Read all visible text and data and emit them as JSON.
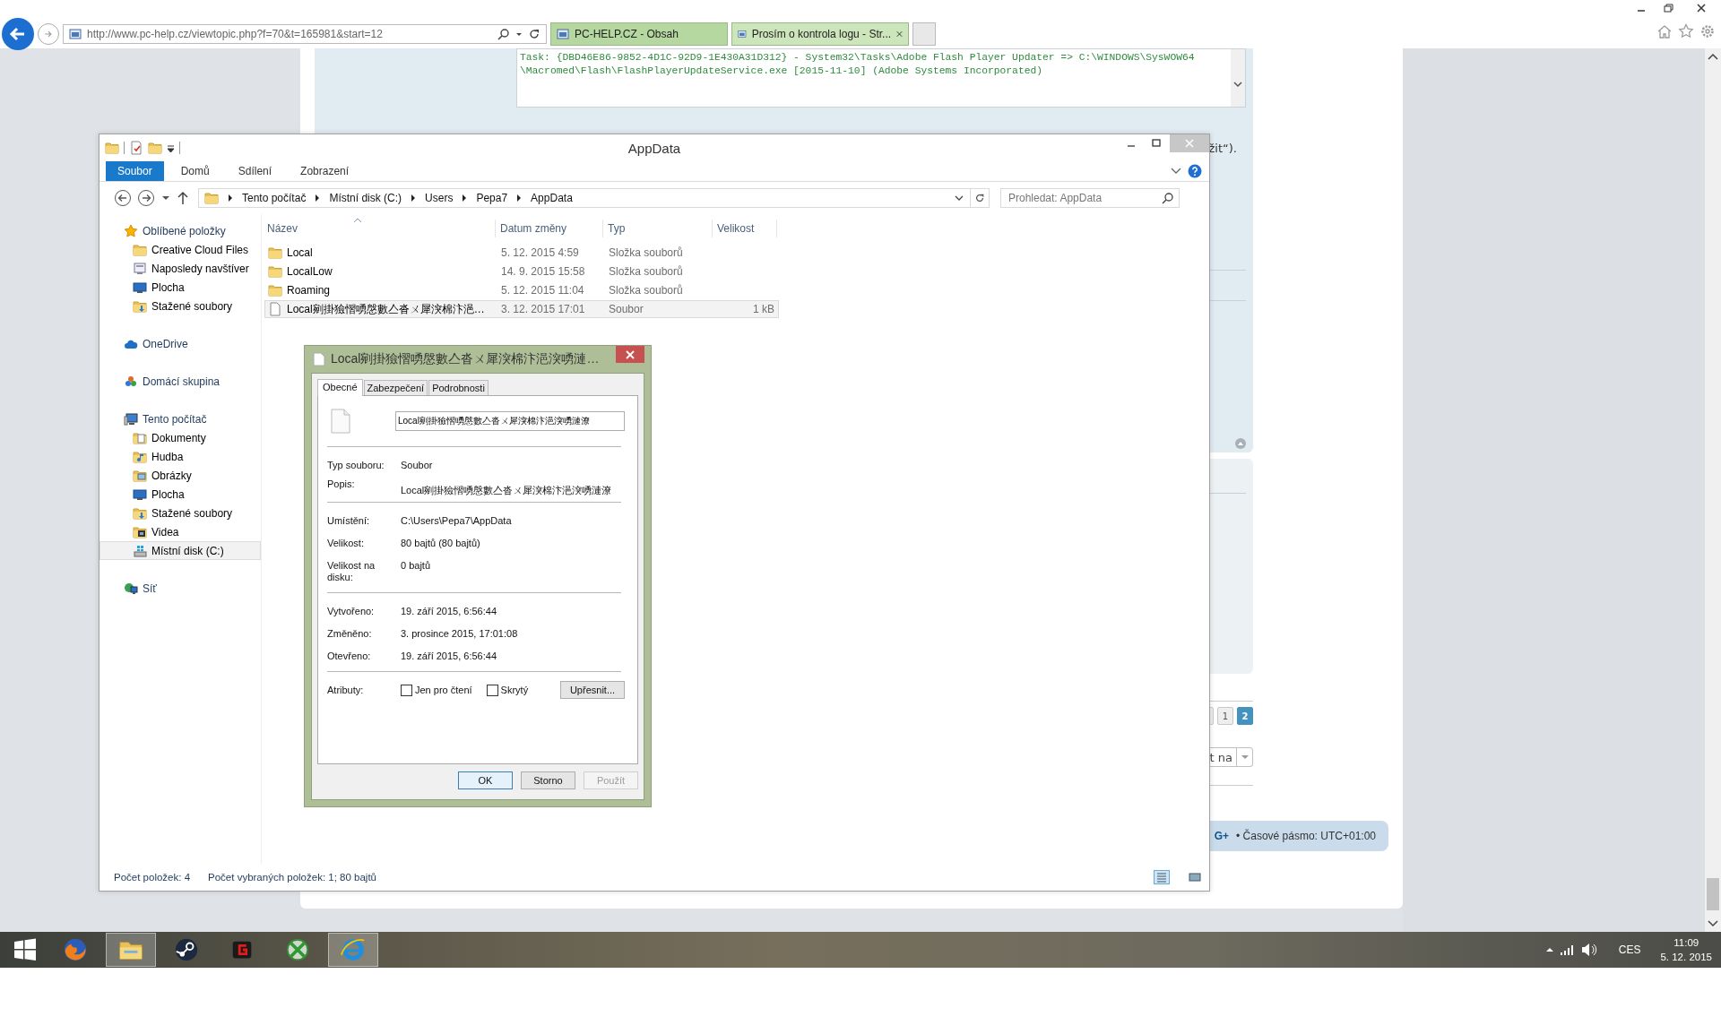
{
  "browser": {
    "address": "http://www.pc-help.cz/viewtopic.php?f=70&t=165981&start=12",
    "tabs": [
      {
        "title": "PC-HELP.CZ - Obsah",
        "selected": false
      },
      {
        "title": "Prosím o kontrola logu - Str...",
        "selected": true
      }
    ]
  },
  "page": {
    "code_lines": [
      "Task: {DBD46E86-9852-4D1C-92D9-1E430A31D312} - System32\\Tasks\\Adobe Flash Player Updater => C:\\WINDOWS\\SysWOW64",
      "\\Macromed\\Flash\\FlashPlayerUpdateService.exe [2015-11-10] (Adobe Systems Incorporated)"
    ],
    "post_text": "žit“).",
    "pagination": [
      {
        "label": "1",
        "selected": false
      },
      {
        "label": "2",
        "selected": true
      }
    ],
    "jump_select": "t na",
    "footer_link": "G+",
    "footer_text": "• Časové pásmo: UTC+01:00"
  },
  "explorer": {
    "title": "AppData",
    "ribbon_tabs": [
      {
        "label": "Soubor",
        "selected": true
      },
      {
        "label": "Domů",
        "selected": false
      },
      {
        "label": "Sdílení",
        "selected": false
      },
      {
        "label": "Zobrazení",
        "selected": false
      }
    ],
    "breadcrumb": [
      "Tento počítač",
      "Místní disk (C:)",
      "Users",
      "Pepa7",
      "AppData"
    ],
    "search": {
      "placeholder": "Prohledat: AppData"
    },
    "sidebar": [
      {
        "label": "Oblíbené položky",
        "kind": "star",
        "selected": false,
        "children": [
          {
            "label": "Creative Cloud Files",
            "kind": "folder",
            "selected": false
          },
          {
            "label": "Naposledy navštíver",
            "kind": "recent",
            "selected": false
          },
          {
            "label": "Plocha",
            "kind": "desktop",
            "selected": false
          },
          {
            "label": "Stažené soubory",
            "kind": "downloads",
            "selected": false
          }
        ]
      },
      {
        "label": "OneDrive",
        "kind": "cloud",
        "selected": false
      },
      {
        "label": "Domácí skupina",
        "kind": "homegroup",
        "selected": false
      },
      {
        "label": "Tento počítač",
        "kind": "computer",
        "selected": false,
        "children": [
          {
            "label": "Dokumenty",
            "kind": "documents",
            "selected": false
          },
          {
            "label": "Hudba",
            "kind": "music",
            "selected": false
          },
          {
            "label": "Obrázky",
            "kind": "pictures",
            "selected": false
          },
          {
            "label": "Plocha",
            "kind": "desktop",
            "selected": false
          },
          {
            "label": "Stažené soubory",
            "kind": "downloads",
            "selected": false
          },
          {
            "label": "Videa",
            "kind": "videos",
            "selected": false
          },
          {
            "label": "Místní disk (C:)",
            "kind": "drive",
            "selected": true
          }
        ]
      },
      {
        "label": "Síť",
        "kind": "network",
        "selected": false
      }
    ],
    "columns": [
      "Název",
      "Datum změny",
      "Typ",
      "Velikost"
    ],
    "rows": [
      {
        "kind": "folder",
        "name": "Local",
        "date": "5. 12. 2015 4:59",
        "type": "Složka souborů",
        "selected": false
      },
      {
        "kind": "folder",
        "name": "LocalLow",
        "date": "14. 9. 2015 15:58",
        "type": "Složka souborů",
        "selected": false
      },
      {
        "kind": "folder",
        "name": "Roaming",
        "date": "5. 12. 2015 11:04",
        "type": "Složka souborů",
        "selected": false
      },
      {
        "kind": "file",
        "name": "Local剜掛獫慴㗈慇數亼沓ㄨ犀湥棉汴浥…",
        "date": "3. 12. 2015 17:01",
        "type": "Soubor",
        "size": "1 kB",
        "selected": true
      }
    ],
    "status": [
      "Počet položek: 4",
      "Počet vybraných položek: 1; 80 bajtů"
    ]
  },
  "dialog": {
    "title": "Local剜掛獫慴㗈慇數亼沓ㄨ犀湥棉汴浥湥㗈漣…",
    "tabs": [
      {
        "label": "Obecné",
        "selected": true
      },
      {
        "label": "Zabezpečení",
        "selected": false
      },
      {
        "label": "Podrobnosti",
        "selected": false
      }
    ],
    "name_value": "Local剜掛獫慴㗈慇數亼沓ㄨ犀湥棉汴浥湥㗈漣潦",
    "sections": [
      [
        {
          "label": "Typ souboru:",
          "value": "Soubor"
        },
        {
          "label": "Popis:",
          "value": "Local剜掛獫慴㗈慇數亼沓ㄨ犀湥棉汴浥湥㗈漣潦"
        }
      ],
      [
        {
          "label": "Umístění:",
          "value": "C:\\Users\\Pepa7\\AppData"
        },
        {
          "label": "Velikost:",
          "value": "80 bajtů (80 bajtů)"
        },
        {
          "label": "Velikost na disku:",
          "value": "0 bajtů"
        }
      ],
      [
        {
          "label": "Vytvořeno:",
          "value": "19. září 2015, 6:56:44"
        },
        {
          "label": "Změněno:",
          "value": "3. prosince 2015, 17:01:08"
        },
        {
          "label": "Otevřeno:",
          "value": "19. září 2015, 6:56:44"
        }
      ]
    ],
    "attributes_label": "Atributy:",
    "attributes": [
      {
        "label": "Jen pro čtení",
        "checked": false
      },
      {
        "label": "Skrytý",
        "checked": false
      }
    ],
    "advanced_button": "Upřesnit...",
    "buttons": [
      {
        "label": "OK",
        "default": true,
        "disabled": false
      },
      {
        "label": "Storno",
        "default": false,
        "disabled": false
      },
      {
        "label": "Použít",
        "default": false,
        "disabled": true
      }
    ]
  },
  "taskbar": {
    "apps": [
      {
        "kind": "firefox",
        "active": false
      },
      {
        "kind": "explorer",
        "active": true
      },
      {
        "kind": "steam",
        "active": false
      },
      {
        "kind": "game",
        "active": false
      },
      {
        "kind": "sphere",
        "active": false
      },
      {
        "kind": "ie",
        "active": true
      }
    ],
    "language": "CES",
    "time": "11:09",
    "date": "5. 12. 2015"
  }
}
